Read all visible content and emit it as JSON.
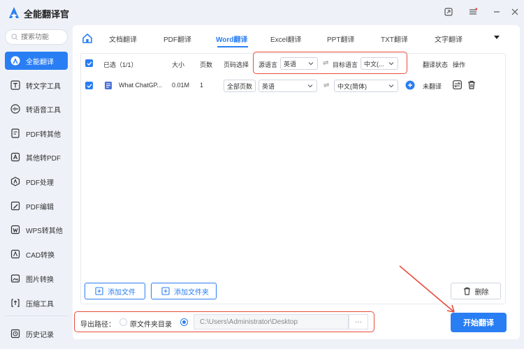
{
  "app": {
    "title": "全能翻译官"
  },
  "search": {
    "placeholder": "搜索功能"
  },
  "sidebar": {
    "items": [
      {
        "label": "全能翻译",
        "icon": "translate-icon",
        "active": true
      },
      {
        "label": "转文字工具",
        "icon": "text-t-icon"
      },
      {
        "label": "转语音工具",
        "icon": "audio-wave-icon"
      },
      {
        "label": "PDF转其他",
        "icon": "pdf-convert-icon"
      },
      {
        "label": "其他转PDF",
        "icon": "to-pdf-icon"
      },
      {
        "label": "PDF处理",
        "icon": "pdf-process-icon"
      },
      {
        "label": "PDF编辑",
        "icon": "pdf-edit-icon"
      },
      {
        "label": "WPS转其他",
        "icon": "wps-icon"
      },
      {
        "label": "CAD转换",
        "icon": "cad-icon"
      },
      {
        "label": "图片转换",
        "icon": "image-icon"
      },
      {
        "label": "压缩工具",
        "icon": "compress-icon"
      }
    ],
    "history": "历史记录"
  },
  "tabs": [
    "文档翻译",
    "PDF翻译",
    "Word翻译",
    "Excel翻译",
    "PPT翻译",
    "TXT翻译",
    "文字翻译"
  ],
  "active_tab": "Word翻译",
  "table": {
    "headers": {
      "selected": "已选（1/1）",
      "size": "大小",
      "pages": "页数",
      "page_select": "页码选择",
      "source_lang": "源语言",
      "source_value": "英语",
      "target_lang": "目标语言",
      "target_value": "中文(...",
      "status": "翻译状态",
      "actions": "操作"
    },
    "rows": [
      {
        "filename": "What ChatGP...",
        "size": "0.01M",
        "pages": "1",
        "page_button": "全部页数",
        "source": "英语",
        "target": "中文(简体)",
        "status": "未翻译"
      }
    ]
  },
  "buttons": {
    "add_file": "添加文件",
    "add_folder": "添加文件夹",
    "delete": "删除",
    "start": "开始翻译",
    "browse": "···"
  },
  "export": {
    "label": "导出路径：",
    "option_source": "原文件夹目录",
    "path": "C:\\Users\\Administrator\\Desktop"
  },
  "colors": {
    "accent": "#2a7ef3",
    "highlight": "#e74c3c"
  }
}
